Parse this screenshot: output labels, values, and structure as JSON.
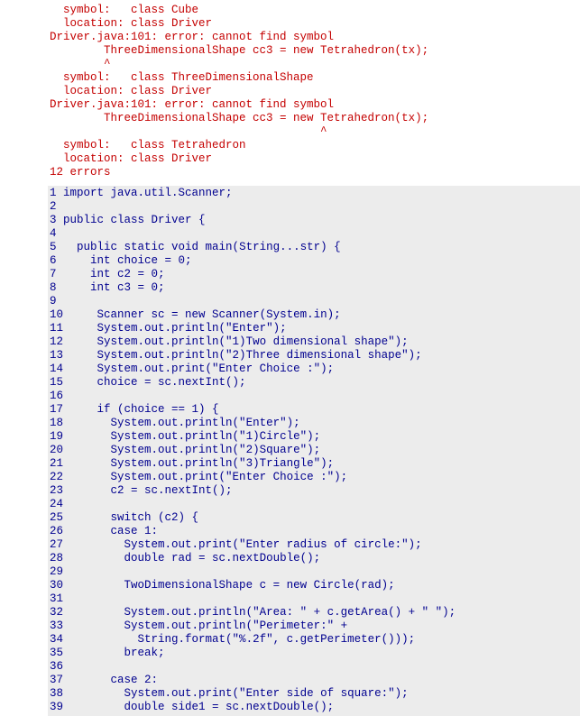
{
  "error_output": {
    "lines": [
      "  symbol:   class Cube",
      "  location: class Driver",
      "Driver.java:101: error: cannot find symbol",
      "        ThreeDimensionalShape cc3 = new Tetrahedron(tx);",
      "        ^",
      "  symbol:   class ThreeDimensionalShape",
      "  location: class Driver",
      "Driver.java:101: error: cannot find symbol",
      "        ThreeDimensionalShape cc3 = new Tetrahedron(tx);",
      "                                        ^",
      "  symbol:   class Tetrahedron",
      "  location: class Driver",
      "12 errors"
    ],
    "error_count_label": "12 errors",
    "color": "#c40000"
  },
  "code": {
    "background": "#ececec",
    "text_color": "#00008f",
    "lines": [
      {
        "n": "1",
        "src": "import java.util.Scanner;"
      },
      {
        "n": "2",
        "src": ""
      },
      {
        "n": "3",
        "src": "public class Driver {"
      },
      {
        "n": "4",
        "src": ""
      },
      {
        "n": "5",
        "src": "  public static void main(String...str) {"
      },
      {
        "n": "6",
        "src": "    int choice = 0;"
      },
      {
        "n": "7",
        "src": "    int c2 = 0;"
      },
      {
        "n": "8",
        "src": "    int c3 = 0;"
      },
      {
        "n": "9",
        "src": ""
      },
      {
        "n": "10",
        "src": "    Scanner sc = new Scanner(System.in);"
      },
      {
        "n": "11",
        "src": "    System.out.println(\"Enter\");"
      },
      {
        "n": "12",
        "src": "    System.out.println(\"1)Two dimensional shape\");"
      },
      {
        "n": "13",
        "src": "    System.out.println(\"2)Three dimensional shape\");"
      },
      {
        "n": "14",
        "src": "    System.out.print(\"Enter Choice :\");"
      },
      {
        "n": "15",
        "src": "    choice = sc.nextInt();"
      },
      {
        "n": "16",
        "src": ""
      },
      {
        "n": "17",
        "src": "    if (choice == 1) {"
      },
      {
        "n": "18",
        "src": "      System.out.println(\"Enter\");"
      },
      {
        "n": "19",
        "src": "      System.out.println(\"1)Circle\");"
      },
      {
        "n": "20",
        "src": "      System.out.println(\"2)Square\");"
      },
      {
        "n": "21",
        "src": "      System.out.println(\"3)Triangle\");"
      },
      {
        "n": "22",
        "src": "      System.out.print(\"Enter Choice :\");"
      },
      {
        "n": "23",
        "src": "      c2 = sc.nextInt();"
      },
      {
        "n": "24",
        "src": ""
      },
      {
        "n": "25",
        "src": "      switch (c2) {"
      },
      {
        "n": "26",
        "src": "      case 1:"
      },
      {
        "n": "27",
        "src": "        System.out.print(\"Enter radius of circle:\");"
      },
      {
        "n": "28",
        "src": "        double rad = sc.nextDouble();"
      },
      {
        "n": "29",
        "src": ""
      },
      {
        "n": "30",
        "src": "        TwoDimensionalShape c = new Circle(rad);"
      },
      {
        "n": "31",
        "src": ""
      },
      {
        "n": "32",
        "src": "        System.out.println(\"Area: \" + c.getArea() + \" \");"
      },
      {
        "n": "33",
        "src": "        System.out.println(\"Perimeter:\" +"
      },
      {
        "n": "34",
        "src": "          String.format(\"%.2f\", c.getPerimeter()));"
      },
      {
        "n": "35",
        "src": "        break;"
      },
      {
        "n": "36",
        "src": ""
      },
      {
        "n": "37",
        "src": "      case 2:"
      },
      {
        "n": "38",
        "src": "        System.out.print(\"Enter side of square:\");"
      },
      {
        "n": "39",
        "src": "        double side1 = sc.nextDouble();"
      }
    ]
  }
}
